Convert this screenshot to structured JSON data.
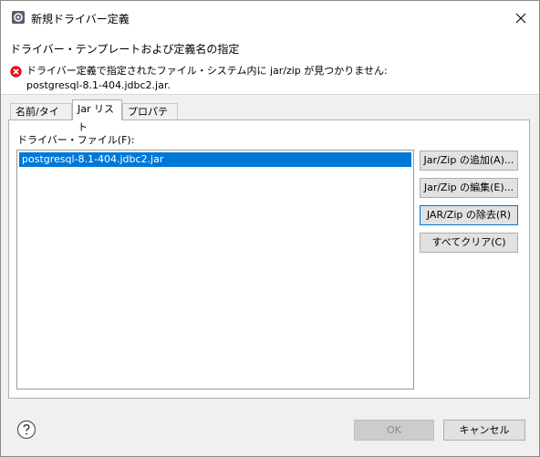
{
  "window": {
    "title": "新規ドライバー定義",
    "icon": "settings-dialog-icon",
    "close_icon": "close-icon"
  },
  "header": {
    "title": "ドライバー・テンプレートおよび定義名の指定",
    "error_icon": "error-icon",
    "error_message": "ドライバー定義で指定されたファイル・システム内に jar/zip が見つかりません: postgresql-8.1-404.jdbc2.jar."
  },
  "tabs": [
    {
      "label": "名前/タイプ",
      "active": false
    },
    {
      "label": "Jar リスト",
      "active": true
    },
    {
      "label": "プロパティー",
      "active": false
    }
  ],
  "jar_panel": {
    "files_label": "ドライバー・ファイル(F):",
    "files": [
      "postgresql-8.1-404.jdbc2.jar"
    ],
    "selected_index": 0,
    "buttons": {
      "add": "Jar/Zip の追加(A)...",
      "edit": "Jar/Zip の編集(E)...",
      "remove": "JAR/Zip の除去(R)",
      "clear": "すべてクリア(C)"
    }
  },
  "footer": {
    "help_icon": "help-icon",
    "ok_label": "OK",
    "ok_enabled": false,
    "cancel_label": "キャンセル"
  },
  "colors": {
    "selection": "#0078d7",
    "error": "#e81123",
    "dialog_bg": "#f0f0f0"
  }
}
